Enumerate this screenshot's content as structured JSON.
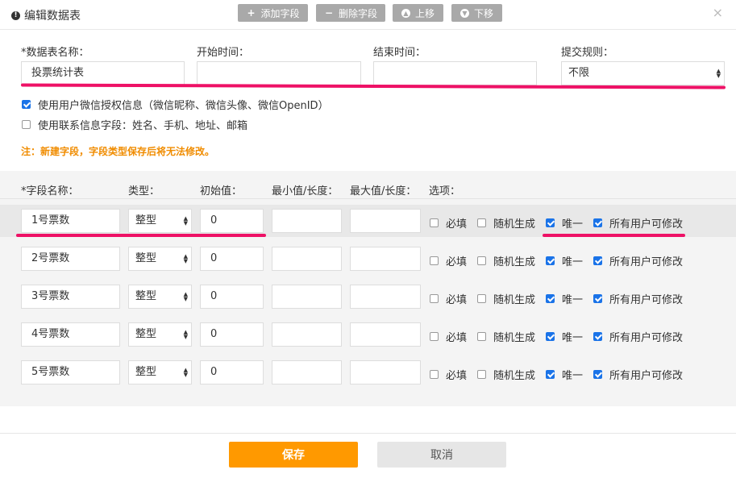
{
  "dialog": {
    "title": "编辑数据表",
    "toolbar": {
      "add_field": "添加字段",
      "delete_field": "删除字段",
      "move_up": "上移",
      "move_down": "下移"
    },
    "close_symbol": "×"
  },
  "form": {
    "name_label": "*数据表名称：",
    "name_value": "投票统计表",
    "start_label": "开始时间：",
    "start_value": "",
    "end_label": "结束时间：",
    "end_value": "",
    "rule_label": "提交规则：",
    "rule_value": "不限",
    "use_wechat_label": "使用用户微信授权信息（微信昵称、微信头像、微信OpenID）",
    "use_wechat_checked": true,
    "use_contact_label": "使用联系信息字段：姓名、手机、地址、邮箱",
    "use_contact_checked": false,
    "note": "注：新建字段，字段类型保存后将无法修改。"
  },
  "fields_table": {
    "headers": {
      "name": "*字段名称：",
      "type": "类型：",
      "initial": "初始值：",
      "min": "最小值/长度：",
      "max": "最大值/长度：",
      "options": "选项："
    },
    "option_labels": {
      "required": "必填",
      "random": "随机生成",
      "unique": "唯一",
      "editable": "所有用户可修改"
    },
    "rows": [
      {
        "name": "1号票数",
        "type": "整型",
        "initial": "0",
        "min": "",
        "max": "",
        "required": false,
        "random": false,
        "unique": true,
        "editable": true
      },
      {
        "name": "2号票数",
        "type": "整型",
        "initial": "0",
        "min": "",
        "max": "",
        "required": false,
        "random": false,
        "unique": true,
        "editable": true
      },
      {
        "name": "3号票数",
        "type": "整型",
        "initial": "0",
        "min": "",
        "max": "",
        "required": false,
        "random": false,
        "unique": true,
        "editable": true
      },
      {
        "name": "4号票数",
        "type": "整型",
        "initial": "0",
        "min": "",
        "max": "",
        "required": false,
        "random": false,
        "unique": true,
        "editable": true
      },
      {
        "name": "5号票数",
        "type": "整型",
        "initial": "0",
        "min": "",
        "max": "",
        "required": false,
        "random": false,
        "unique": true,
        "editable": true
      }
    ]
  },
  "footer": {
    "save": "保存",
    "cancel": "取消"
  },
  "colors": {
    "accent": "#ff9900",
    "annotation": "#ee1166",
    "checkbox": "#1a73e8",
    "toolbar_button": "#a9a9a9",
    "note": "#f08c00"
  }
}
